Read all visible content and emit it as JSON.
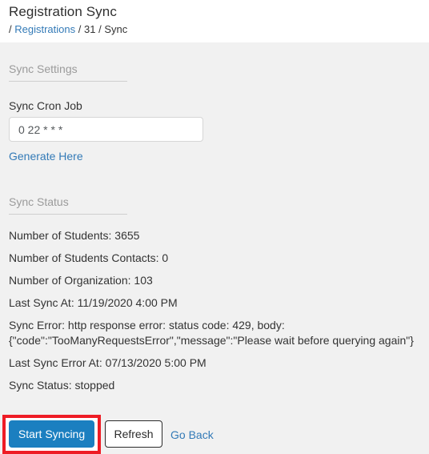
{
  "header": {
    "title": "Registration Sync",
    "breadcrumb": {
      "sep1": "/",
      "link": "Registrations",
      "sep2": "/",
      "id": "31",
      "sep3": "/",
      "current": "Sync"
    }
  },
  "sync_settings": {
    "legend": "Sync Settings",
    "cron_field": {
      "label": "Sync Cron Job",
      "value": "0 22 * * *",
      "placeholder": ""
    },
    "generate_link": "Generate Here"
  },
  "sync_status": {
    "legend": "Sync Status",
    "lines": [
      "Number of Students: 3655",
      "Number of Students Contacts: 0",
      "Number of Organization: 103",
      "Last Sync At: 11/19/2020 4:00 PM",
      "Sync Error: http response error: status code: 429, body: {\"code\":\"TooManyRequestsError\",\"message\":\"Please wait before querying again\"}",
      "Last Sync Error At: 07/13/2020 5:00 PM",
      "Sync Status: stopped"
    ],
    "fields": {
      "number_of_students": "3655",
      "number_of_students_contacts": "0",
      "number_of_organization": "103",
      "last_sync_at": "11/19/2020 4:00 PM",
      "sync_error": "http response error: status code: 429, body: {\"code\":\"TooManyRequestsError\",\"message\":\"Please wait before querying again\"}",
      "last_sync_error_at": "07/13/2020 5:00 PM",
      "status": "stopped"
    }
  },
  "actions": {
    "start_syncing_label": "Start Syncing",
    "refresh_label": "Refresh",
    "go_back_label": "Go Back"
  },
  "colors": {
    "accent_blue": "#1b7fc0",
    "link_blue": "#337ab7",
    "highlight_red": "#ee1c25",
    "page_background": "#f1f1f1",
    "header_background": "#ffffff",
    "legend_text": "#9b9b9b"
  }
}
